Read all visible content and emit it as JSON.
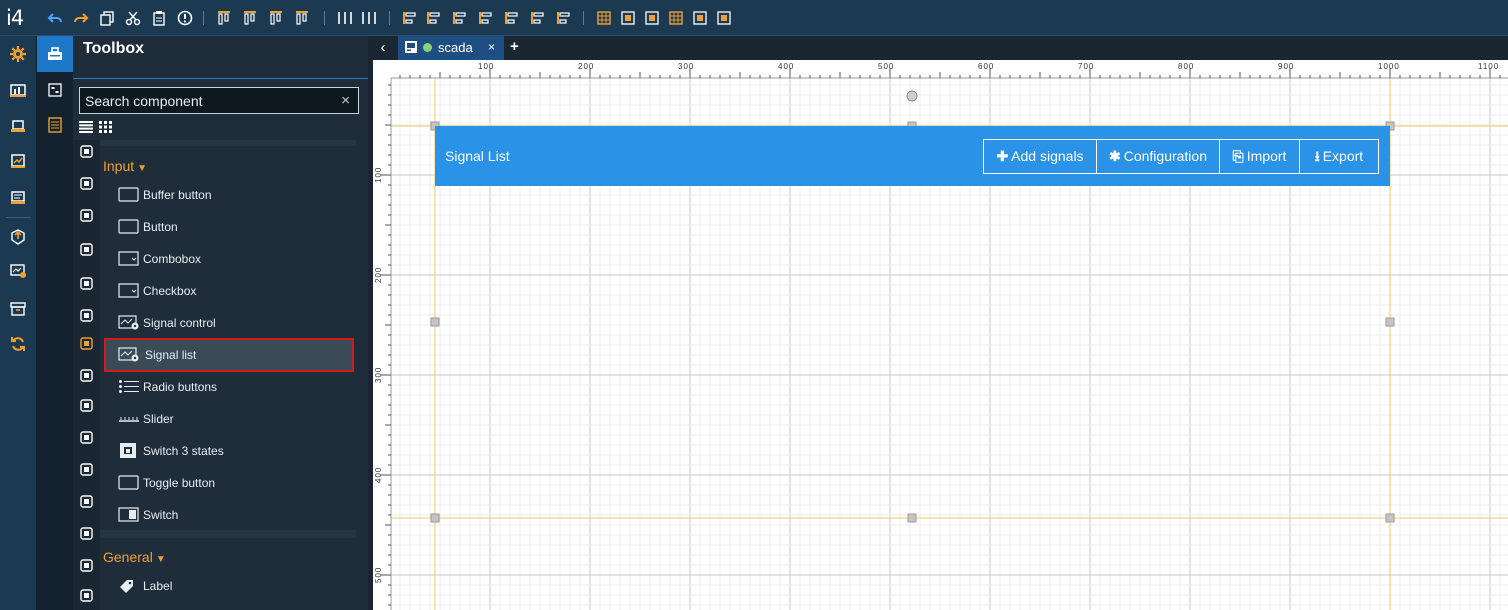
{
  "app": {
    "logo": "i4"
  },
  "toolbar": {
    "icons": [
      "undo-icon",
      "redo-icon",
      "copy-icon",
      "cut-icon",
      "paste-icon",
      "info-icon",
      "bring-front-icon",
      "send-back-icon",
      "bring-forward-icon",
      "send-backward-icon",
      "distribute-h-icon",
      "distribute-v-icon",
      "align-left-icon",
      "align-right-icon",
      "align-top-icon",
      "align-bottom-icon",
      "align-center-h-icon",
      "align-center-v-icon",
      "align-selection-icon",
      "grid-icon",
      "ruler-icon",
      "snap-icon",
      "grid-settings-icon",
      "guides-icon",
      "fit-icon"
    ]
  },
  "toolbox": {
    "title": "Toolbox",
    "search_placeholder": "Search component",
    "search_clear": "×",
    "categories": [
      {
        "name": "Input",
        "items": [
          {
            "label": "Buffer button",
            "icon": "buffer-button-icon"
          },
          {
            "label": "Button",
            "icon": "button-icon"
          },
          {
            "label": "Combobox",
            "icon": "combobox-icon"
          },
          {
            "label": "Checkbox",
            "icon": "checkbox-icon"
          },
          {
            "label": "Signal control",
            "icon": "signal-control-icon"
          },
          {
            "label": "Signal list",
            "icon": "signal-list-icon",
            "selected": true
          },
          {
            "label": "Radio buttons",
            "icon": "radio-buttons-icon"
          },
          {
            "label": "Slider",
            "icon": "slider-icon"
          },
          {
            "label": "Switch 3 states",
            "icon": "switch-3-states-icon"
          },
          {
            "label": "Toggle button",
            "icon": "toggle-button-icon"
          },
          {
            "label": "Switch",
            "icon": "switch-icon"
          }
        ]
      },
      {
        "name": "General",
        "items": [
          {
            "label": "Label",
            "icon": "label-icon"
          }
        ]
      }
    ]
  },
  "tabs": {
    "back": "‹",
    "open": [
      {
        "name": "scada",
        "close": "×",
        "status_color": "#8bd17a"
      }
    ],
    "add": "+"
  },
  "ruler": {
    "h_labels": [
      "100",
      "200",
      "300",
      "400",
      "500",
      "600",
      "700",
      "800",
      "900",
      "1000",
      "1100"
    ],
    "v_labels": [
      "100",
      "200",
      "300",
      "400",
      "500"
    ]
  },
  "widget": {
    "title": "Signal List",
    "buttons": [
      {
        "label": "Add signals",
        "icon": "plus-icon",
        "glyph": "✚"
      },
      {
        "label": "Configuration",
        "icon": "gear-icon",
        "glyph": "✱"
      },
      {
        "label": "Import",
        "icon": "import-icon",
        "glyph": "⎘"
      },
      {
        "label": "Export",
        "icon": "export-icon",
        "glyph": "⭳"
      }
    ]
  },
  "colors": {
    "accent": "#2a93e8",
    "toolbar_icon": "#f0a030",
    "category": "#f0a030",
    "selection_border": "#d01c1c",
    "guide": "#f2c85b"
  }
}
